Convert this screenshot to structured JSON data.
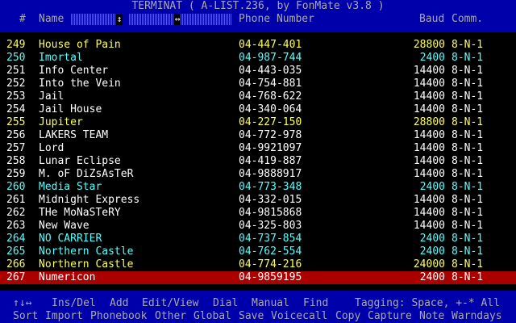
{
  "header": {
    "title": "TERMINAT ( A-LIST.236, by FonMate v3.8 )",
    "col_num": "#",
    "col_name": "Name",
    "col_phone": "Phone Number",
    "col_baud": "Baud",
    "col_comm": "Comm.",
    "handle_1": "↕",
    "handle_2": "↔"
  },
  "entries": [
    {
      "num": "249",
      "name": "House of Pain",
      "phone": "04-447-401",
      "baud": "28800",
      "comm": "8-N-1",
      "color": "y"
    },
    {
      "num": "250",
      "name": "Imortal",
      "phone": "04-987-744",
      "baud": "2400",
      "comm": "8-N-1",
      "color": "c"
    },
    {
      "num": "251",
      "name": "Info Center",
      "phone": "04-443-035",
      "baud": "14400",
      "comm": "8-N-1",
      "color": "w"
    },
    {
      "num": "252",
      "name": "Into the Vein",
      "phone": "04-754-881",
      "baud": "14400",
      "comm": "8-N-1",
      "color": "w"
    },
    {
      "num": "253",
      "name": "Jail",
      "phone": "04-768-622",
      "baud": "14400",
      "comm": "8-N-1",
      "color": "w"
    },
    {
      "num": "254",
      "name": "Jail House",
      "phone": "04-340-064",
      "baud": "14400",
      "comm": "8-N-1",
      "color": "w"
    },
    {
      "num": "255",
      "name": "Jupiter",
      "phone": "04-227-150",
      "baud": "28800",
      "comm": "8-N-1",
      "color": "y"
    },
    {
      "num": "256",
      "name": "LAKERS TEAM",
      "phone": "04-772-978",
      "baud": "14400",
      "comm": "8-N-1",
      "color": "w"
    },
    {
      "num": "257",
      "name": "Lord",
      "phone": "04-9921097",
      "baud": "14400",
      "comm": "8-N-1",
      "color": "w"
    },
    {
      "num": "258",
      "name": "Lunar Eclipse",
      "phone": "04-419-887",
      "baud": "14400",
      "comm": "8-N-1",
      "color": "w"
    },
    {
      "num": "259",
      "name": "M. oF DiZsAsTeR",
      "phone": "04-9888917",
      "baud": "14400",
      "comm": "8-N-1",
      "color": "w"
    },
    {
      "num": "260",
      "name": "Media Star",
      "phone": "04-773-348",
      "baud": "2400",
      "comm": "8-N-1",
      "color": "c"
    },
    {
      "num": "261",
      "name": "Midnight Express",
      "phone": "04-332-015",
      "baud": "14400",
      "comm": "8-N-1",
      "color": "w"
    },
    {
      "num": "262",
      "name": "THe MoNaSTeRY",
      "phone": "04-9815868",
      "baud": "14400",
      "comm": "8-N-1",
      "color": "w"
    },
    {
      "num": "263",
      "name": "New Wave",
      "phone": "04-325-803",
      "baud": "14400",
      "comm": "8-N-1",
      "color": "w"
    },
    {
      "num": "264",
      "name": "NO CARRIER",
      "phone": "04-737-854",
      "baud": "2400",
      "comm": "8-N-1",
      "color": "c"
    },
    {
      "num": "265",
      "name": "Northern Castle",
      "phone": "04-762-554",
      "baud": "2400",
      "comm": "8-N-1",
      "color": "c"
    },
    {
      "num": "266",
      "name": "Northern Castle",
      "phone": "04-774-216",
      "baud": "24000",
      "comm": "8-N-1",
      "color": "y"
    },
    {
      "num": "267",
      "name": "Numericon",
      "phone": "04-9859195",
      "baud": "2400",
      "comm": "8-N-1",
      "color": "w",
      "selected": true
    }
  ],
  "footer": {
    "row1": {
      "arrows": "↑↓↔",
      "ins_del": "Ins/Del",
      "add": "Add",
      "edit_view": "Edit/View",
      "dial": "Dial",
      "manual": "Manual",
      "find": "Find",
      "tagging": "Tagging: Space, +-* All"
    },
    "row2": {
      "sort": "Sort",
      "import": "Import",
      "phonebook": "Phonebook",
      "other": "Other",
      "global": "Global",
      "save": "Save",
      "voicecall": "Voicecall",
      "copy": "Copy",
      "capture": "Capture",
      "note": "Note",
      "warndays": "Warndays"
    }
  },
  "colors": {
    "header_bg": "#0000aa",
    "selection_bg": "#aa0000",
    "white": "#ffffff",
    "yellow": "#ffff55",
    "cyan": "#55ffff"
  }
}
